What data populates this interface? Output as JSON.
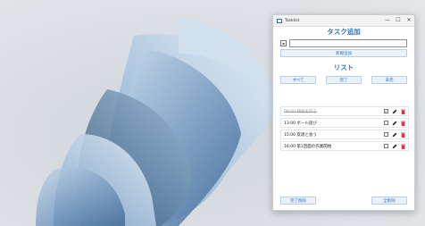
{
  "window": {
    "title": "Tasklist"
  },
  "window_controls": {
    "minimize": "—",
    "maximize": "☐",
    "close": "✕"
  },
  "add_section": {
    "title": "タスク追加",
    "input_value": "",
    "add_button": "新規追加"
  },
  "list_section": {
    "title": "リスト",
    "filters": [
      "すべて",
      "完了",
      "未完"
    ]
  },
  "tasks": [
    {
      "text": "08:00 朝食を作る",
      "done": true
    },
    {
      "text": "13:00 ボール遊び",
      "done": false
    },
    {
      "text": "15:00 友達と会う",
      "done": false
    },
    {
      "text": "16:00 第1回面の作業開始",
      "done": false
    }
  ],
  "footer": {
    "clear_done": "完了削除",
    "clear_all": "全削除"
  },
  "colors": {
    "accent": "#2f72c4",
    "delete": "#d9373b",
    "button_bg": "#e9f1fb"
  }
}
